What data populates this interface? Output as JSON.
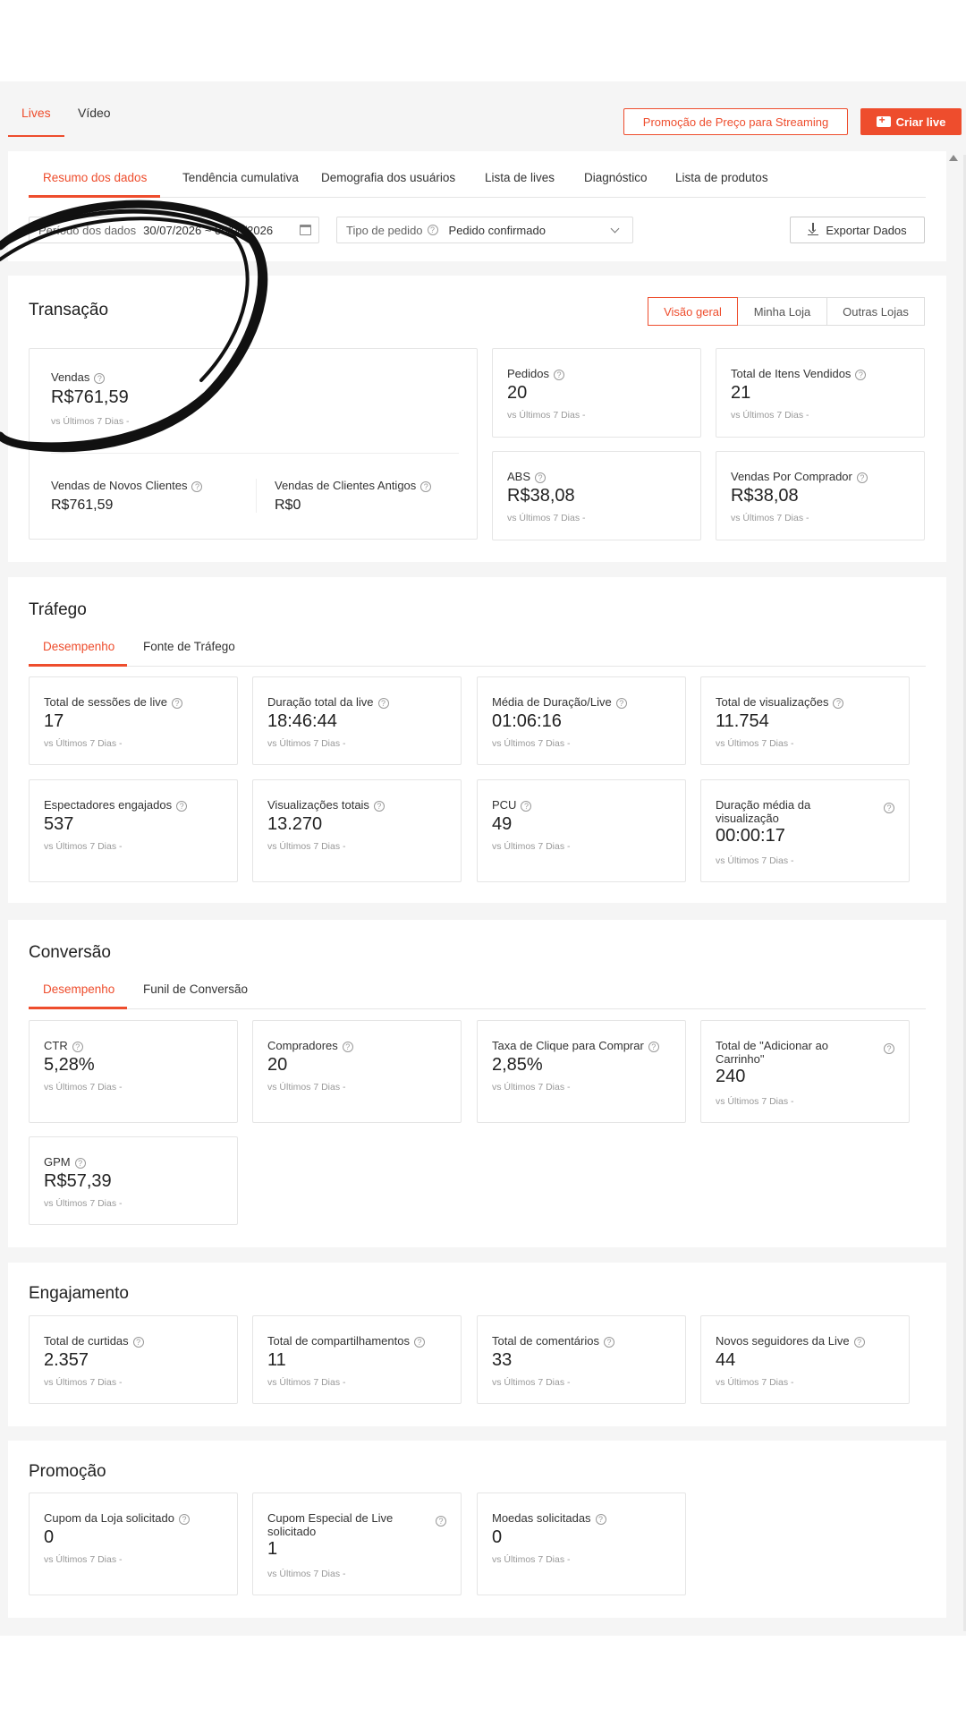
{
  "top_tabs": [
    "Lives",
    "Vídeo"
  ],
  "header_buttons": {
    "promo": "Promoção de Preço para Streaming",
    "create": "Criar live"
  },
  "main_tabs": [
    "Resumo dos dados",
    "Tendência cumulativa",
    "Demografia dos usuários",
    "Lista de lives",
    "Diagnóstico",
    "Lista de produtos"
  ],
  "filters": {
    "period_label": "Período dos dados",
    "period_value": "30/07/2026 ~ 05/08/2026",
    "order_type_label": "Tipo de pedido",
    "order_type_value": "Pedido confirmado",
    "export": "Exportar Dados"
  },
  "compare_text": "vs Últimos 7 Dias  -",
  "transacao": {
    "title": "Transação",
    "segments": [
      "Visão geral",
      "Minha Loja",
      "Outras Lojas"
    ],
    "main": {
      "label": "Vendas",
      "value": "R$761,59"
    },
    "sub": [
      {
        "label": "Vendas de Novos Clientes",
        "value": "R$761,59"
      },
      {
        "label": "Vendas de Clientes Antigos",
        "value": "R$0"
      }
    ],
    "cards": [
      {
        "label": "Pedidos",
        "value": "20"
      },
      {
        "label": "Total de Itens Vendidos",
        "value": "21"
      },
      {
        "label": "ABS",
        "value": "R$38,08"
      },
      {
        "label": "Vendas Por Comprador",
        "value": "R$38,08"
      }
    ]
  },
  "trafego": {
    "title": "Tráfego",
    "tabs": [
      "Desempenho",
      "Fonte de Tráfego"
    ],
    "cards": [
      {
        "label": "Total de sessões de live",
        "value": "17"
      },
      {
        "label": "Duração total da live",
        "value": "18:46:44"
      },
      {
        "label": "Média de Duração/Live",
        "value": "01:06:16"
      },
      {
        "label": "Total de visualizações",
        "value": "11.754"
      },
      {
        "label": "Espectadores engajados",
        "value": "537"
      },
      {
        "label": "Visualizações totais",
        "value": "13.270"
      },
      {
        "label": "PCU",
        "value": "49"
      },
      {
        "label": "Duração média da visualização",
        "value": "00:00:17"
      }
    ]
  },
  "conversao": {
    "title": "Conversão",
    "tabs": [
      "Desempenho",
      "Funil de Conversão"
    ],
    "cards": [
      {
        "label": "CTR",
        "value": "5,28%"
      },
      {
        "label": "Compradores",
        "value": "20"
      },
      {
        "label": "Taxa de Clique para Comprar",
        "value": "2,85%"
      },
      {
        "label": "Total de \"Adicionar ao Carrinho\"",
        "value": "240"
      },
      {
        "label": "GPM",
        "value": "R$57,39"
      }
    ]
  },
  "engajamento": {
    "title": "Engajamento",
    "cards": [
      {
        "label": "Total de curtidas",
        "value": "2.357"
      },
      {
        "label": "Total de compartilhamentos",
        "value": "11"
      },
      {
        "label": "Total de comentários",
        "value": "33"
      },
      {
        "label": "Novos seguidores da Live",
        "value": "44"
      }
    ]
  },
  "promocao": {
    "title": "Promoção",
    "cards": [
      {
        "label": "Cupom da Loja solicitado",
        "value": "0"
      },
      {
        "label": "Cupom Especial de Live solicitado",
        "value": "1"
      },
      {
        "label": "Moedas solicitadas",
        "value": "0"
      }
    ]
  },
  "colors": {
    "accent": "#ee4d2d",
    "background": "#f5f5f5",
    "card_border": "#e5e5e5"
  }
}
